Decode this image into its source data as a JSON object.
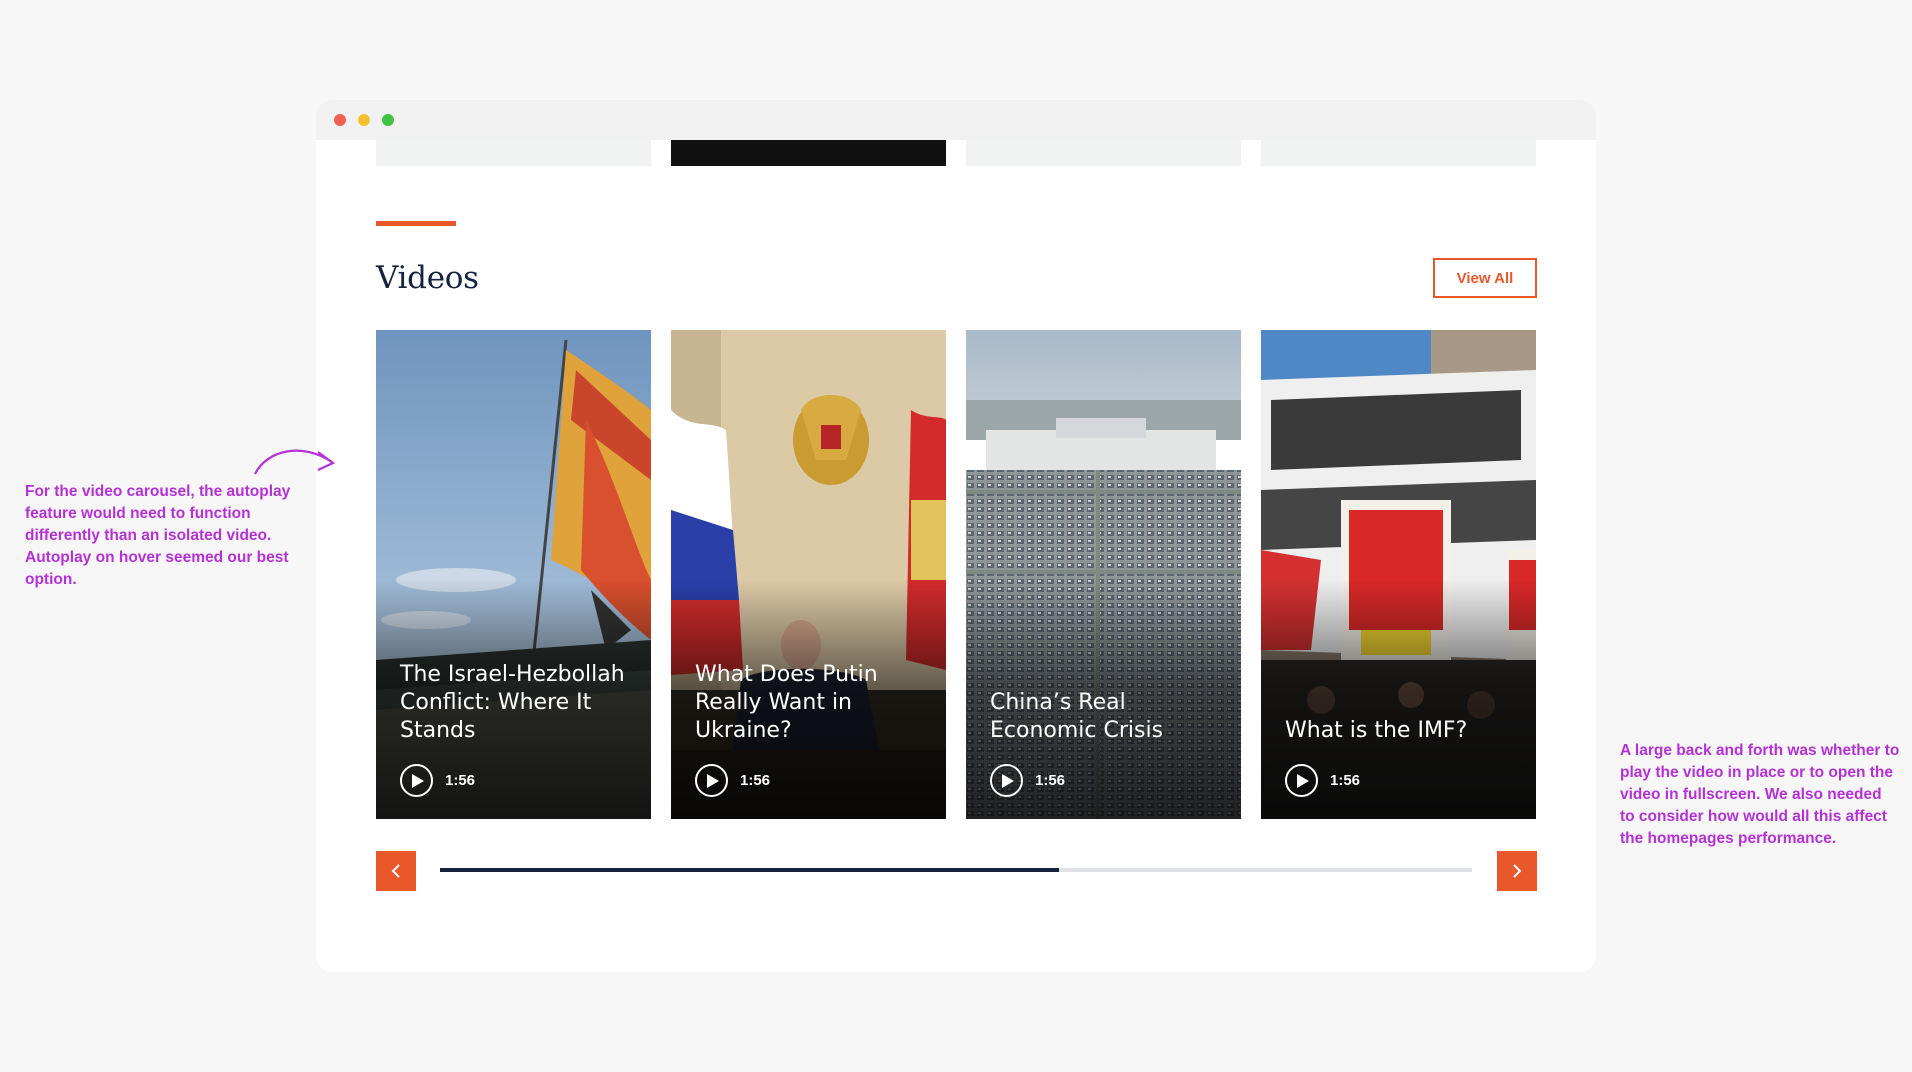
{
  "section": {
    "title": "Videos",
    "view_all_label": "View All"
  },
  "colors": {
    "accent": "#e8582b",
    "navy": "#15233f",
    "annotation": "#b531d6"
  },
  "cards": [
    {
      "title": "The Israel-Hezbollah Conflict: Where It Stands",
      "duration": "1:56"
    },
    {
      "title": "What Does Putin Really Want in Ukraine?",
      "duration": "1:56"
    },
    {
      "title": "China’s Real Economic Crisis",
      "duration": "1:56"
    },
    {
      "title": "What is the IMF?",
      "duration": "1:56"
    }
  ],
  "carousel": {
    "progress": 0.6,
    "prev_icon": "chevron-left-icon",
    "next_icon": "chevron-right-icon"
  },
  "annotations": {
    "left": "For the video carousel, the autoplay feature would need to function differently than an isolated video. Autoplay on hover seemed our best option.",
    "right": "A large back and forth was whether to play the video in place or to open the video in fullscreen. We also needed to consider how would all this affect the homepages performance."
  }
}
